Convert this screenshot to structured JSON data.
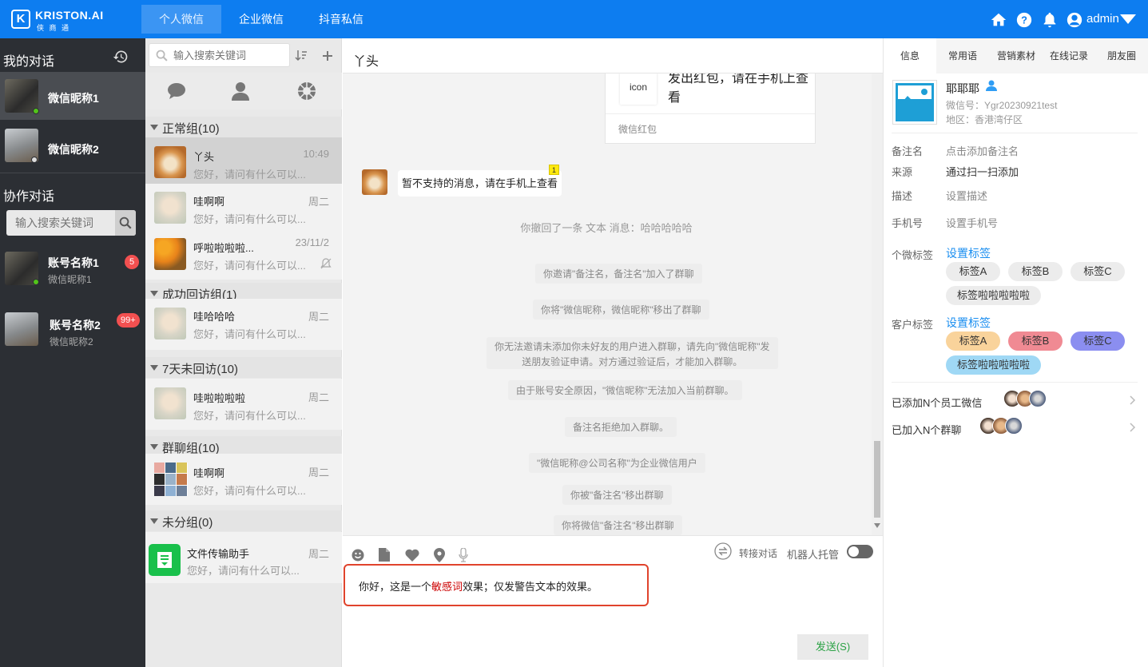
{
  "brand": {
    "name": "KRISTON.AI",
    "sub": "侠 商 通",
    "mark": "K"
  },
  "top_tabs": [
    "个人微信",
    "企业微信",
    "抖音私信"
  ],
  "user": {
    "name": "admin"
  },
  "left": {
    "my_title": "我的对话",
    "collab_title": "协作对话",
    "search_placeholder": "输入搜索关键词",
    "my_convs": [
      {
        "name": "微信昵称1",
        "status": "online"
      },
      {
        "name": "微信昵称2",
        "status": "offline"
      }
    ],
    "accounts": [
      {
        "name": "账号名称1",
        "sub": "微信昵称1",
        "badge": "5"
      },
      {
        "name": "账号名称2",
        "sub": "微信昵称2",
        "badge": "99+"
      }
    ]
  },
  "contacts": {
    "search_placeholder": "输入搜索关键词",
    "groups": [
      {
        "title": "正常组(10)",
        "items": [
          {
            "name": "丫头",
            "msg": "您好，请问有什么可以...",
            "time": "10:49"
          },
          {
            "name": "哇啊啊",
            "msg": "您好，请问有什么可以...",
            "time": "周二"
          },
          {
            "name": "呼啦啦啦啦...",
            "msg": "您好，请问有什么可以...",
            "time": "23/11/2"
          }
        ]
      },
      {
        "title": "成功回访组(1)",
        "items": [
          {
            "name": "哇哈哈哈",
            "msg": "您好，请问有什么可以...",
            "time": "周二"
          }
        ]
      },
      {
        "title": "7天未回访(10)",
        "items": [
          {
            "name": "哇啦啦啦啦",
            "msg": "您好，请问有什么可以...",
            "time": "周二"
          }
        ]
      },
      {
        "title": "群聊组(10)",
        "items": [
          {
            "name": "哇啊啊",
            "msg": "您好，请问有什么可以...",
            "time": "周二"
          }
        ]
      },
      {
        "title": "未分组(0)",
        "items": [
          {
            "name": "文件传输助手",
            "msg": "您好，请问有什么可以...",
            "time": "周二"
          }
        ]
      }
    ]
  },
  "chat": {
    "title": "丫头",
    "redpacket": {
      "icon_text": "icon",
      "text": "发出红包，请在手机上查看",
      "footer": "微信红包"
    },
    "unsupported": {
      "text": "暂不支持的消息，请在手机上查看",
      "count": "1"
    },
    "system_messages": [
      "你撤回了一条 文本 消息：哈哈哈哈哈",
      "你邀请\"备注名，备注名\"加入了群聊",
      "你将\"微信昵称，微信昵称\"移出了群聊",
      "你无法邀请未添加你未好友的用户进入群聊，请先向\"微信昵称\"发",
      "送朋友验证申请。对方通过验证后，才能加入群聊。",
      "由于账号安全原因，\"微信昵称\"无法加入当前群聊。",
      "备注名拒绝加入群聊。",
      "\"微信昵称@公司名称\"为企业微信用户",
      "你被\"备注名\"移出群聊",
      "你将微信\"备注名\"移出群聊"
    ],
    "transfer_label": "转接对话",
    "robot_label": "机器人托管",
    "input": {
      "before": "你好，这是一个",
      "sensitive": "敏感词",
      "after": "效果；仅发警告文本的效果。"
    },
    "send_label": "发送(S)"
  },
  "right": {
    "tabs": [
      "信息",
      "常用语",
      "营销素材",
      "在线记录",
      "朋友圈"
    ],
    "profile": {
      "name": "耶耶耶",
      "wechat_id": "微信号：Ygr20230921test",
      "region": "地区：香港湾仔区"
    },
    "fields": [
      {
        "label": "备注名",
        "value": "点击添加备注名"
      },
      {
        "label": "来源",
        "value": "通过扫一扫添加"
      },
      {
        "label": "描述",
        "value": "设置描述"
      },
      {
        "label": "手机号",
        "value": "设置手机号"
      }
    ],
    "personal_tags": {
      "label": "个微标签",
      "link": "设置标签",
      "tags": [
        "标签A",
        "标签B",
        "标签C",
        "标签啦啦啦啦啦"
      ]
    },
    "customer_tags": {
      "label": "客户标签",
      "link": "设置标签",
      "tags": [
        "标签A",
        "标签B",
        "标签C",
        "标签啦啦啦啦啦"
      ]
    },
    "tag_colors": [
      "#f9d39b",
      "#f08a93",
      "#8b8ef0",
      "#9fd8f5"
    ],
    "staff_added": "已添加N个员工微信",
    "groups_joined": "已加入N个群聊"
  }
}
